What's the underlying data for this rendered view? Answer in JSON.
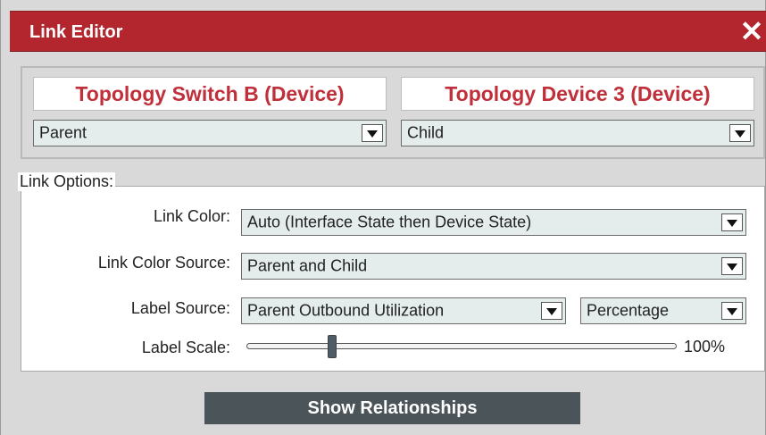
{
  "window": {
    "title": "Link Editor",
    "close_glyph": "✕",
    "close_icon": "close-icon"
  },
  "devices": {
    "parent_name": "Topology Switch B (Device)",
    "child_name": "Topology Device 3 (Device)",
    "parent_role": "Parent",
    "child_role": "Child"
  },
  "link_options": {
    "legend": "Link Options:",
    "link_color_label": "Link Color:",
    "link_color_value": "Auto (Interface State then Device State)",
    "link_color_source_label": "Link Color Source:",
    "link_color_source_value": "Parent and Child",
    "label_source_label": "Label Source:",
    "label_source_value": "Parent Outbound Utilization",
    "label_format_value": "Percentage",
    "label_scale_label": "Label Scale:",
    "label_scale_value": "100%",
    "label_scale_slider_fraction": 0.2
  },
  "actions": {
    "show_relationships": "Show Relationships"
  },
  "colors": {
    "titlebar": "#b3262d",
    "device_text": "#c0303a",
    "button": "#4b5459",
    "select_bg": "#e4ecec"
  }
}
